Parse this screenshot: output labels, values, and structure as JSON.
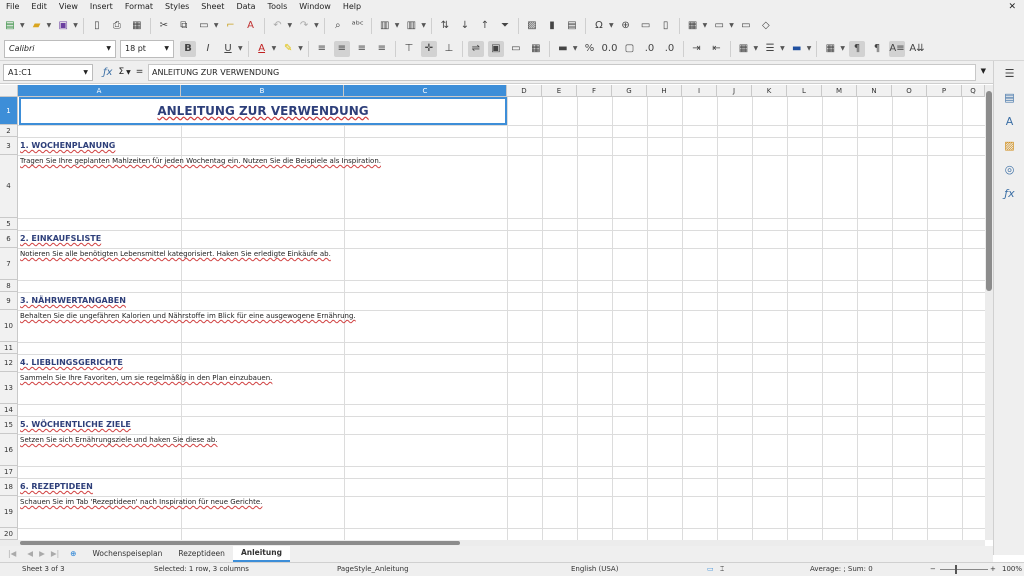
{
  "menu": [
    "File",
    "Edit",
    "View",
    "Insert",
    "Format",
    "Styles",
    "Sheet",
    "Data",
    "Tools",
    "Window",
    "Help"
  ],
  "font": {
    "name": "Calibri",
    "size": "18 pt"
  },
  "formula": {
    "cell_ref": "A1:C1",
    "content": "ANLEITUNG ZUR VERWENDUNG"
  },
  "columns": [
    "A",
    "B",
    "C",
    "D",
    "E",
    "F",
    "G",
    "H",
    "I",
    "J",
    "K",
    "L",
    "M",
    "N",
    "O",
    "P",
    "Q"
  ],
  "rows": [
    "1",
    "2",
    "3",
    "4",
    "5",
    "6",
    "7",
    "8",
    "9",
    "10",
    "11",
    "12",
    "13",
    "14",
    "15",
    "16",
    "17",
    "18",
    "19",
    "20"
  ],
  "sheet_content": {
    "title": "ANLEITUNG ZUR VERWENDUNG",
    "h1": "1. WOCHENPLANUNG",
    "t1": "Tragen Sie Ihre geplanten Mahlzeiten für jeden Wochentag ein. Nutzen Sie die Beispiele als Inspiration.",
    "h2": "2. EINKAUFSLISTE",
    "t2": "Notieren Sie alle benötigten Lebensmittel kategorisiert. Haken Sie erledigte Einkäufe ab.",
    "h3": "3. NÄHRWERTANGABEN",
    "t3": "Behalten Sie die ungefähren Kalorien und Nährstoffe im Blick für eine ausgewogene Ernährung.",
    "h4": "4. LIEBLINGSGERICHTE",
    "t4": "Sammeln Sie Ihre Favoriten, um sie regelmäßig in den Plan einzubauen.",
    "h5": "5. WÖCHENTLICHE ZIELE",
    "t5": "Setzen Sie sich Ernährungsziele und haken Sie diese ab.",
    "h6": "6. REZEPTIDEEN",
    "t6": "Schauen Sie im Tab 'Rezeptideen' nach Inspiration für neue Gerichte."
  },
  "tabs": [
    "Wochenspeiseplan",
    "Rezeptideen",
    "Anleitung"
  ],
  "active_tab": "Anleitung",
  "status": {
    "sheet": "Sheet 3 of 3",
    "selection": "Selected: 1 row, 3 columns",
    "page_style": "PageStyle_Anleitung",
    "language": "English (USA)",
    "sum": "Average: ; Sum: 0",
    "zoom": "100%"
  },
  "colors": {
    "accent": "#3d8ed8",
    "heading": "#2e3f7a"
  }
}
